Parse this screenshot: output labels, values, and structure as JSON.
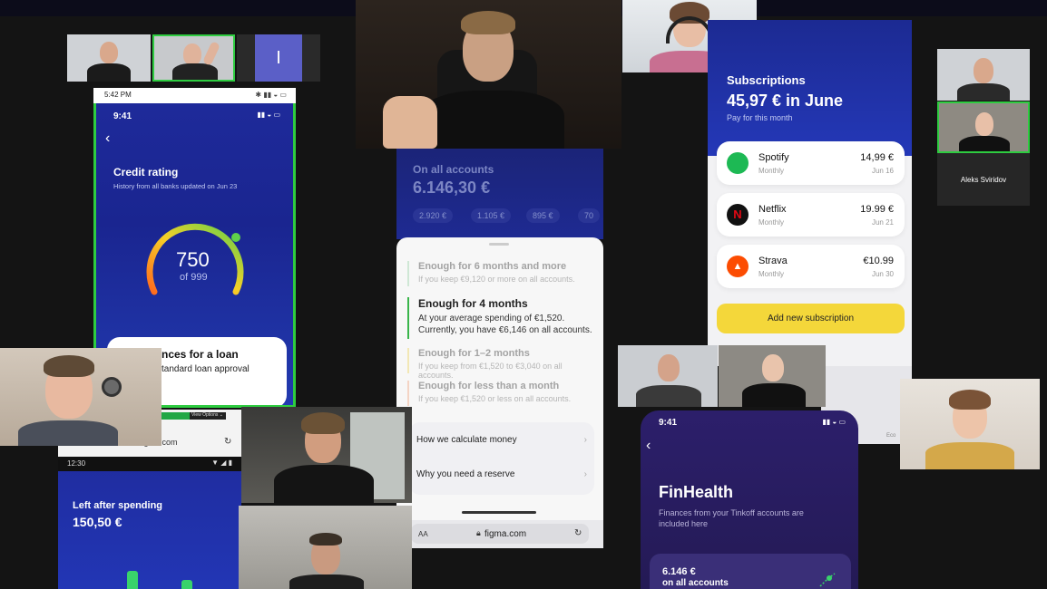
{
  "sidebar_thumbnails": {
    "placeholder_initial": "I"
  },
  "android_status": {
    "time": "5:42 PM"
  },
  "credit_phone": {
    "time": "9:41",
    "title": "Credit rating",
    "subtitle": "History from all banks updated on Jun 23",
    "score": "750",
    "score_of": "of 999",
    "card_title": "nces for a loan",
    "card_sub": "tandard loan approval"
  },
  "browser_small": {
    "view_options": "View Options ⌄",
    "url_fragment": "figma.com",
    "time": "12:30"
  },
  "left_after": {
    "label": "Left after spending",
    "amount": "150,50 €"
  },
  "accounts": {
    "label": "On all accounts",
    "total": "6.146,30 €",
    "pills": [
      "2.920 €",
      "1.105 €",
      "895 €",
      "70"
    ]
  },
  "reserve_sheet": {
    "options": [
      {
        "title": "Enough for 6 months and more",
        "sub": "If you keep €9,120 or more on all accounts."
      },
      {
        "title": "Enough for 4 months",
        "sub": "At your average spending of €1,520. Currently, you have €6,146 on all accounts."
      },
      {
        "title": "Enough for 1–2 months",
        "sub": "If you keep from €1,520 to €3,040 on all accounts."
      },
      {
        "title": "Enough for less than a month",
        "sub": "If you keep €1,520 or less on all accounts."
      }
    ],
    "links": [
      "How we calculate money",
      "Why you need a reserve"
    ],
    "browser_aa": "AA",
    "browser_url": "figma.com"
  },
  "subscriptions": {
    "title": "Subscriptions",
    "amount": "45,97 € in June",
    "sub": "Pay for this month",
    "items": [
      {
        "name": "Spotify",
        "period": "Monthly",
        "price": "14,99 €",
        "date": "Jun 16",
        "color": "#1db954"
      },
      {
        "name": "Netflix",
        "period": "Monthly",
        "price": "19.99 €",
        "date": "Jun 21",
        "color": "#111111"
      },
      {
        "name": "Strava",
        "period": "Monthly",
        "price": "€10.99",
        "date": "Jun 30",
        "color": "#fc4c02"
      }
    ],
    "add_button": "Add new subscription",
    "bottom_fragment": "Eco"
  },
  "participant": {
    "name": "Aleks Sviridov"
  },
  "finhealth": {
    "time": "9:41",
    "title": "FinHealth",
    "sub": "Finances from your Tinkoff accounts are included here",
    "card_amount": "6.146 €",
    "card_label": "on all accounts"
  },
  "colors": {
    "accent_green": "#39b54a",
    "accent_yellow": "#f4d73a",
    "phone_blue": "#1e2a9a",
    "finhealth_purple": "#2a1f5e"
  }
}
